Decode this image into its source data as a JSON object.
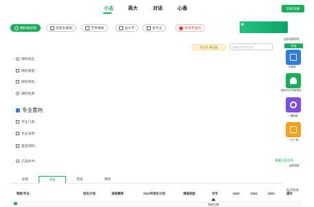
{
  "nav": {
    "items": [
      "小志",
      "高大",
      "对话",
      "心香"
    ],
    "login": "登录/注册"
  },
  "pills": [
    {
      "label": "模拟填志愿",
      "icon": "target-icon"
    },
    {
      "label": "提前批填报",
      "icon": "document-icon"
    },
    {
      "label": "艺考填报",
      "icon": "palette-icon"
    },
    {
      "label": "查大学",
      "icon": "school-icon"
    },
    {
      "label": "查专业",
      "icon": "book-icon"
    },
    {
      "label": "新高考选科",
      "icon": "red-dot-icon"
    }
  ],
  "promo": {
    "tag": "特",
    "caption": "志愿填报特权"
  },
  "side": {
    "title": "特录",
    "items": [
      {
        "label": "志愿表",
        "color": "#2f7be0"
      },
      {
        "label": "预约2023专家规划",
        "color": "#1aad5a"
      },
      {
        "label": "一键填报",
        "color": "#7b4de0"
      },
      {
        "label": "一分一段",
        "color": "#f0a21a"
      }
    ],
    "footer": "返回顶部"
  },
  "eval_button": "开会员 填志愿",
  "search_placeholder": "院校/大学/专业名",
  "filters": {
    "location": "院校地区：",
    "type": "院校类型：",
    "feature": "院校特色：",
    "nature": "院校性质："
  },
  "section_title": "专业意向",
  "major_filters": {
    "category": "专业门类：",
    "major": "专业名称：",
    "heat": "是否排除："
  },
  "selected": {
    "label": "已选条件：",
    "clear": "重置已选条件"
  },
  "tabs": [
    "全部",
    "冲击",
    "稳妥",
    "保底"
  ],
  "table": {
    "headers": [
      "院校/专业",
      "招生计划",
      "录取概率",
      "2024年招生计划",
      "填报热度",
      "历年",
      "2023",
      "2022",
      "2021",
      "操作"
    ],
    "top_header": "批次和填",
    "row": {
      "badge": "冲",
      "cell": "院校分数"
    }
  },
  "colors": {
    "accent": "#1aad5a",
    "danger": "#e2473c"
  }
}
